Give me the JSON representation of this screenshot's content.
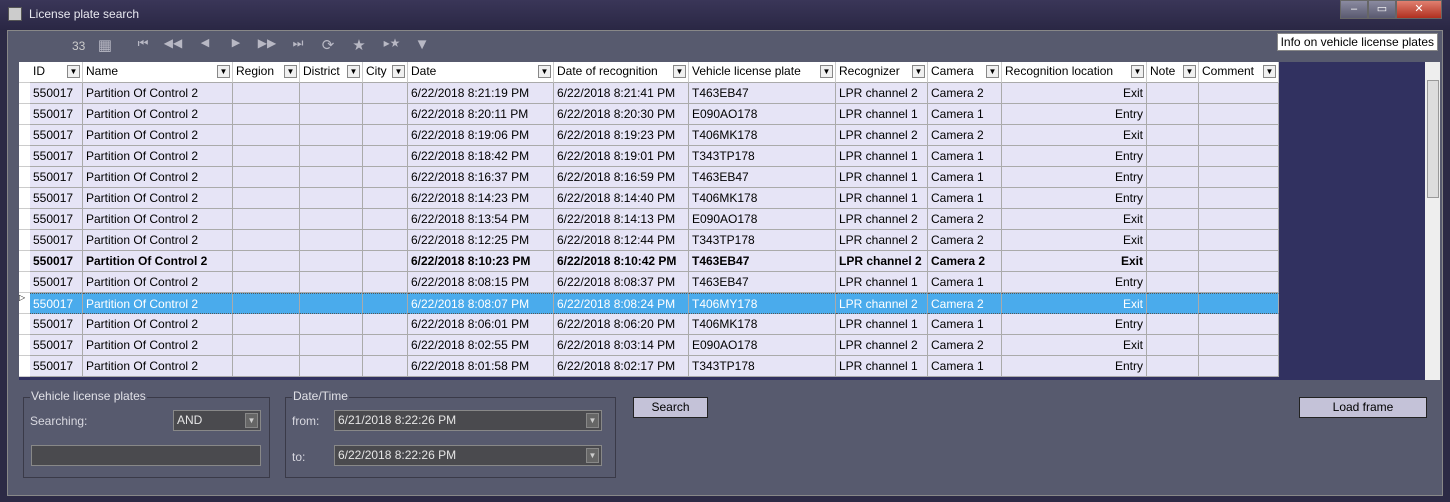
{
  "window": {
    "title": "License plate search",
    "minimize": "–",
    "maximize": "▭",
    "close": "✕"
  },
  "toolbar": {
    "count": "33",
    "info_label": "Info on vehicle license plates",
    "icons": [
      "table-icon",
      "first-icon",
      "prev-page-icon",
      "prev-icon",
      "next-icon",
      "next-page-icon",
      "last-icon",
      "refresh-icon",
      "star-icon",
      "goto-star-icon",
      "filter-icon"
    ]
  },
  "grid": {
    "columns": [
      "ID",
      "Name",
      "Region",
      "District",
      "City",
      "Date",
      "Date of recognition",
      "Vehicle license plate",
      "Recognizer",
      "Camera",
      "Recognition location",
      "Note",
      "Comment"
    ],
    "rows": [
      [
        "550017",
        "Partition  Of Control 2",
        "",
        "",
        "",
        "6/22/2018 8:21:19 PM",
        "6/22/2018 8:21:41 PM",
        "T463EB47",
        "LPR channel 2",
        "Camera 2",
        "Exit",
        "",
        ""
      ],
      [
        "550017",
        "Partition  Of Control 2",
        "",
        "",
        "",
        "6/22/2018 8:20:11 PM",
        "6/22/2018 8:20:30 PM",
        "E090AO178",
        "LPR channel 1",
        "Camera 1",
        "Entry",
        "",
        ""
      ],
      [
        "550017",
        "Partition  Of Control 2",
        "",
        "",
        "",
        "6/22/2018 8:19:06 PM",
        "6/22/2018 8:19:23 PM",
        "T406MK178",
        "LPR channel 2",
        "Camera 2",
        "Exit",
        "",
        ""
      ],
      [
        "550017",
        "Partition  Of Control 2",
        "",
        "",
        "",
        "6/22/2018 8:18:42 PM",
        "6/22/2018 8:19:01 PM",
        "T343TP178",
        "LPR channel 1",
        "Camera 1",
        "Entry",
        "",
        ""
      ],
      [
        "550017",
        "Partition  Of Control 2",
        "",
        "",
        "",
        "6/22/2018 8:16:37 PM",
        "6/22/2018 8:16:59 PM",
        "T463EB47",
        "LPR channel 1",
        "Camera 1",
        "Entry",
        "",
        ""
      ],
      [
        "550017",
        "Partition  Of Control 2",
        "",
        "",
        "",
        "6/22/2018 8:14:23 PM",
        "6/22/2018 8:14:40 PM",
        "T406MK178",
        "LPR channel 1",
        "Camera 1",
        "Entry",
        "",
        ""
      ],
      [
        "550017",
        "Partition  Of Control 2",
        "",
        "",
        "",
        "6/22/2018 8:13:54 PM",
        "6/22/2018 8:14:13 PM",
        "E090AO178",
        "LPR channel 2",
        "Camera 2",
        "Exit",
        "",
        ""
      ],
      [
        "550017",
        "Partition  Of Control 2",
        "",
        "",
        "",
        "6/22/2018 8:12:25 PM",
        "6/22/2018 8:12:44 PM",
        "T343TP178",
        "LPR channel 2",
        "Camera 2",
        "Exit",
        "",
        ""
      ],
      [
        "550017",
        "Partition  Of Control 2",
        "",
        "",
        "",
        "6/22/2018 8:10:23 PM",
        "6/22/2018 8:10:42 PM",
        "T463EB47",
        "LPR channel 2",
        "Camera 2",
        "Exit",
        "",
        ""
      ],
      [
        "550017",
        "Partition  Of Control 2",
        "",
        "",
        "",
        "6/22/2018 8:08:15 PM",
        "6/22/2018 8:08:37 PM",
        "T463EB47",
        "LPR channel 1",
        "Camera 1",
        "Entry",
        "",
        ""
      ],
      [
        "550017",
        "Partition  Of Control 2",
        "",
        "",
        "",
        "6/22/2018 8:08:07 PM",
        "6/22/2018 8:08:24 PM",
        "T406MY178",
        "LPR channel 2",
        "Camera 2",
        "Exit",
        "",
        ""
      ],
      [
        "550017",
        "Partition  Of Control 2",
        "",
        "",
        "",
        "6/22/2018 8:06:01 PM",
        "6/22/2018 8:06:20 PM",
        "T406MK178",
        "LPR channel 1",
        "Camera 1",
        "Entry",
        "",
        ""
      ],
      [
        "550017",
        "Partition  Of Control 2",
        "",
        "",
        "",
        "6/22/2018 8:02:55 PM",
        "6/22/2018 8:03:14 PM",
        "E090AO178",
        "LPR channel 2",
        "Camera 2",
        "Exit",
        "",
        ""
      ],
      [
        "550017",
        "Partition  Of Control 2",
        "",
        "",
        "",
        "6/22/2018 8:01:58 PM",
        "6/22/2018 8:02:17 PM",
        "T343TP178",
        "LPR channel 1",
        "Camera 1",
        "Entry",
        "",
        ""
      ]
    ],
    "bold_row": 8,
    "selected_row": 10,
    "selected_color": "#4aabec"
  },
  "plates": {
    "group_label": "Vehicle license plates",
    "searching_label": "Searching:",
    "searching_value": "AND",
    "plate_input_value": ""
  },
  "datetime": {
    "group_label": "Date/Time",
    "from_label": "from:",
    "from_value": "6/21/2018 8:22:26 PM",
    "to_label": "to:",
    "to_value": "6/22/2018 8:22:26 PM"
  },
  "buttons": {
    "search": "Search",
    "load_frame": "Load frame"
  }
}
